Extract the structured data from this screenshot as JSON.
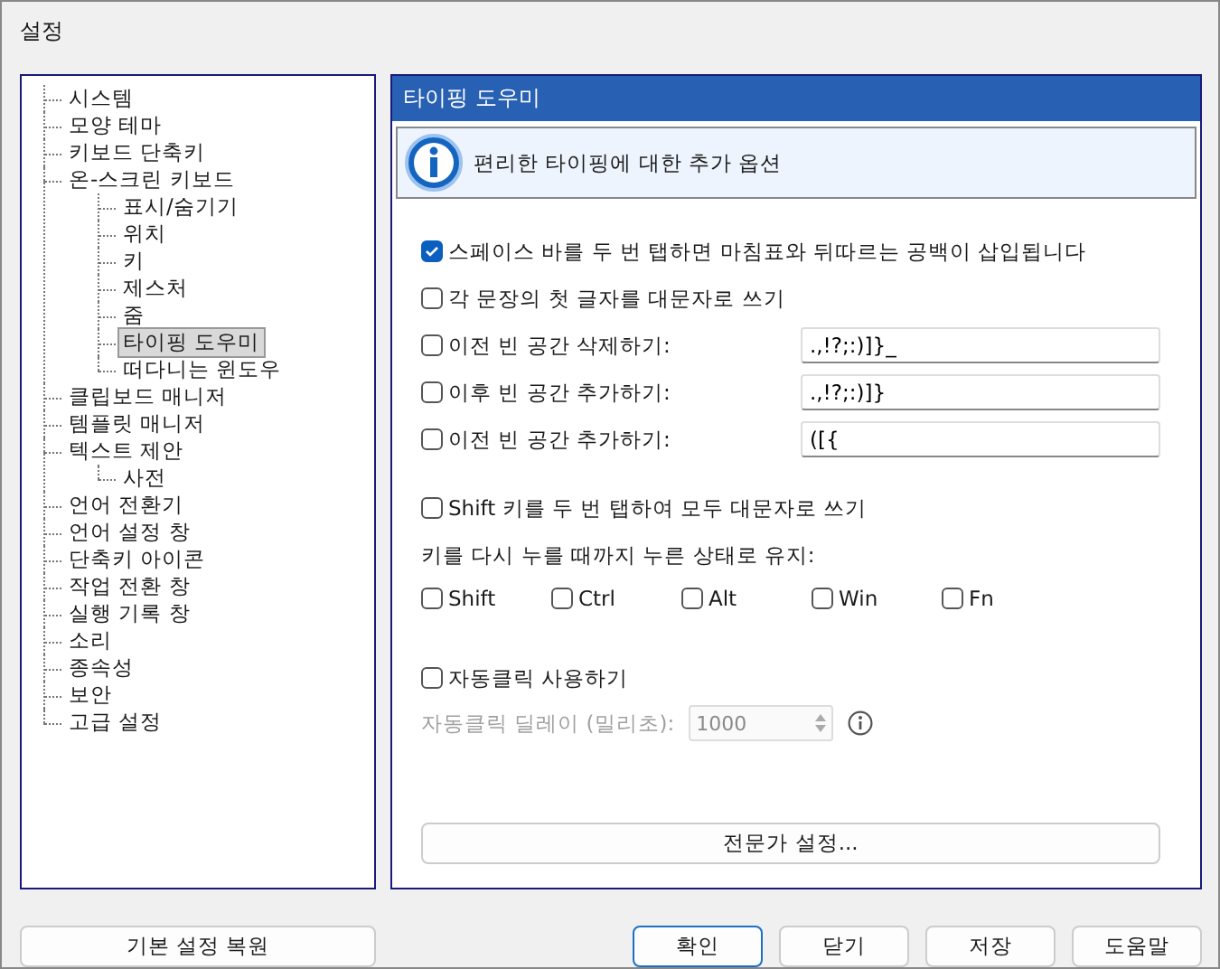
{
  "window": {
    "title": "설정"
  },
  "tree": {
    "items": [
      {
        "label": "시스템",
        "selected": false
      },
      {
        "label": "모양 테마",
        "selected": false
      },
      {
        "label": "키보드 단축키",
        "selected": false
      },
      {
        "label": "온-스크린 키보드",
        "selected": false,
        "children": [
          {
            "label": "표시/숨기기",
            "selected": false
          },
          {
            "label": "위치",
            "selected": false
          },
          {
            "label": "키",
            "selected": false
          },
          {
            "label": "제스처",
            "selected": false
          },
          {
            "label": "줌",
            "selected": false
          },
          {
            "label": "타이핑 도우미",
            "selected": true
          },
          {
            "label": "떠다니는 윈도우",
            "selected": false
          }
        ]
      },
      {
        "label": "클립보드 매니저",
        "selected": false
      },
      {
        "label": "템플릿 매니저",
        "selected": false
      },
      {
        "label": "텍스트 제안",
        "selected": false,
        "children": [
          {
            "label": "사전",
            "selected": false
          }
        ]
      },
      {
        "label": "언어 전환기",
        "selected": false
      },
      {
        "label": "언어 설정 창",
        "selected": false
      },
      {
        "label": "단축키 아이콘",
        "selected": false
      },
      {
        "label": "작업 전환 창",
        "selected": false
      },
      {
        "label": "실행 기록 창",
        "selected": false
      },
      {
        "label": "소리",
        "selected": false
      },
      {
        "label": "종속성",
        "selected": false
      },
      {
        "label": "보안",
        "selected": false
      },
      {
        "label": "고급 설정",
        "selected": false
      }
    ]
  },
  "panel": {
    "title": "타이핑 도우미",
    "info": "편리한 타이핑에 대한 추가 옵션",
    "options": [
      {
        "kind": "check",
        "label": "스페이스 바를 두 번 탭하면 마침표와 뒤따르는 공백이 삽입됩니다",
        "checked": true
      },
      {
        "kind": "check",
        "label": "각 문장의 첫 글자를 대문자로 쓰기",
        "checked": false
      },
      {
        "kind": "field",
        "label": "이전 빈 공간 삭제하기:",
        "checked": false,
        "value": ".,!?;:)]}_"
      },
      {
        "kind": "field",
        "label": "이후 빈 공간 추가하기:",
        "checked": false,
        "value": ".,!?;:)]}"
      },
      {
        "kind": "field",
        "label": "이전 빈 공간 추가하기:",
        "checked": false,
        "value": "([{"
      }
    ],
    "shift_caps": {
      "label": "Shift 키를 두 번 탭하여 모두 대문자로 쓰기",
      "checked": false
    },
    "sticky_label": "키를 다시 누를 때까지 누른 상태로 유지:",
    "sticky_keys": [
      {
        "label": "Shift",
        "checked": false
      },
      {
        "label": "Ctrl",
        "checked": false
      },
      {
        "label": "Alt",
        "checked": false
      },
      {
        "label": "Win",
        "checked": false
      },
      {
        "label": "Fn",
        "checked": false
      }
    ],
    "autoclick": {
      "label": "자동클릭 사용하기",
      "checked": false
    },
    "delay": {
      "label": "자동클릭 딜레이 (밀리초):",
      "value": "1000",
      "disabled": true
    },
    "expert_button": "전문가 설정..."
  },
  "restore_button": "기본 설정 복원",
  "buttons": [
    {
      "label": "확인",
      "default": true
    },
    {
      "label": "닫기",
      "default": false
    },
    {
      "label": "저장",
      "default": false
    },
    {
      "label": "도움말",
      "default": false
    }
  ]
}
